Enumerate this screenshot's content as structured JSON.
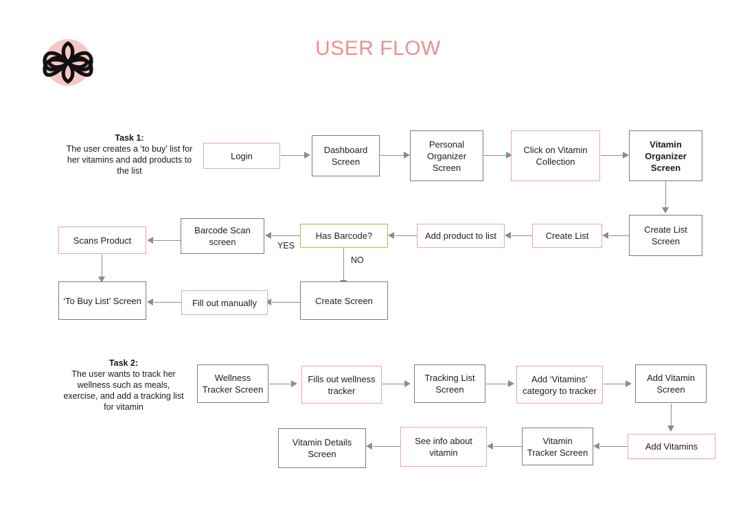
{
  "header": {
    "title": "USER FLOW",
    "title_color": "#f08f8f",
    "logo_icon": "flower-logo-icon",
    "logo_circle_color": "#f9c6c6",
    "logo_stroke_color": "#111111"
  },
  "palette": {
    "accent_pink": "#e8a6a4",
    "border_gray": "#7a7a7a",
    "decision_yellow": "#c9ae44",
    "connector_gray": "#8c8c8c",
    "background": "#ffffff"
  },
  "tasks": [
    {
      "id": "task-1",
      "heading": "Task 1:",
      "description": "The user creates a ‘to buy’ list for her vitamins and add products to the list"
    },
    {
      "id": "task-2",
      "heading": "Task 2:",
      "description": "The user wants to track her wellness such as meals, exercise, and add a tracking list for vitamin"
    }
  ],
  "nodes": [
    {
      "id": "login",
      "label": "Login",
      "style": "pink",
      "bold": false
    },
    {
      "id": "dashboard-screen",
      "label": "Dashboard Screen",
      "style": "gray",
      "bold": false
    },
    {
      "id": "personal-organizer",
      "label": "Personal Organizer Screen",
      "style": "gray",
      "bold": false
    },
    {
      "id": "click-vitamin-collection",
      "label": "Click on Vitamin Collection",
      "style": "pink",
      "bold": false
    },
    {
      "id": "vitamin-organizer",
      "label": "Vitamin Organizer Screen",
      "style": "gray",
      "bold": true
    },
    {
      "id": "create-list-screen",
      "label": "Create List Screen",
      "style": "gray",
      "bold": false
    },
    {
      "id": "create-list",
      "label": "Create List",
      "style": "pink",
      "bold": false
    },
    {
      "id": "add-product-to-list",
      "label": "Add product to list",
      "style": "pink",
      "bold": false
    },
    {
      "id": "has-barcode",
      "label": "Has Barcode?",
      "style": "yellow",
      "bold": false
    },
    {
      "id": "barcode-scan-screen",
      "label": "Barcode Scan screen",
      "style": "gray",
      "bold": false
    },
    {
      "id": "scans-product",
      "label": "Scans Product",
      "style": "pink",
      "bold": false
    },
    {
      "id": "to-buy-list-screen",
      "label": "‘To Buy List’ Screen",
      "style": "gray",
      "bold": false
    },
    {
      "id": "fill-out-manually",
      "label": "Fill out manually",
      "style": "pink",
      "bold": false
    },
    {
      "id": "create-screen",
      "label": "Create Screen",
      "style": "gray",
      "bold": false
    },
    {
      "id": "wellness-tracker-screen",
      "label": "Wellness Tracker Screen",
      "style": "gray",
      "bold": false
    },
    {
      "id": "fills-out-wellness",
      "label": "Fills out wellness tracker",
      "style": "pink",
      "bold": false
    },
    {
      "id": "tracking-list-screen",
      "label": "Tracking List Screen",
      "style": "gray",
      "bold": false
    },
    {
      "id": "add-vitamins-category",
      "label": "Add ‘Vitamins’ category to tracker",
      "style": "pink",
      "bold": false
    },
    {
      "id": "add-vitamin-screen",
      "label": "Add Vitamin Screen",
      "style": "gray",
      "bold": false
    },
    {
      "id": "add-vitamins",
      "label": "Add Vitamins",
      "style": "pink",
      "bold": false
    },
    {
      "id": "vitamin-tracker-screen",
      "label": "Vitamin Tracker Screen",
      "style": "gray",
      "bold": false
    },
    {
      "id": "see-info-about-vitamin",
      "label": "See info about vitamin",
      "style": "pink",
      "bold": false
    },
    {
      "id": "vitamin-details-screen",
      "label": "Vitamin Details Screen",
      "style": "gray",
      "bold": false
    }
  ],
  "edge_labels": [
    {
      "id": "yes-label",
      "text": "YES"
    },
    {
      "id": "no-label",
      "text": "NO"
    }
  ]
}
